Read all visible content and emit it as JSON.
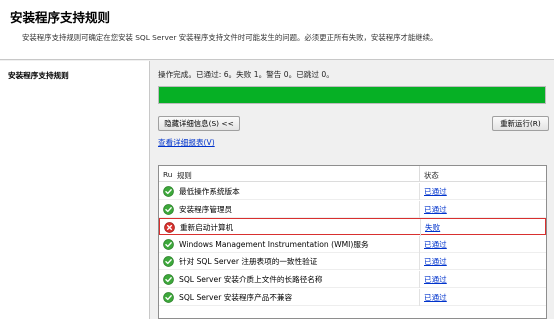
{
  "header": {
    "title": "安装程序支持规则",
    "description": "安装程序支持规则可确定在您安装 SQL Server 安装程序支持文件时可能发生的问题。必须更正所有失败，安装程序才能继续。"
  },
  "sidebar": {
    "items": [
      {
        "label": "安装程序支持规则"
      }
    ]
  },
  "main": {
    "status_text": "操作完成。已通过: 6。失败 1。警告 0。已跳过 0。",
    "progress_fraction": 1.0,
    "progress_color": "#06b025",
    "hide_details_label": "隐藏详细信息(S) <<",
    "rerun_label": "重新运行(R)",
    "report_link": "查看详细报表(V)",
    "table": {
      "headers": {
        "ru": "Ru",
        "rule": "规则",
        "status": "状态"
      },
      "rows": [
        {
          "icon": "check-circle-icon",
          "rule": "最低操作系统版本",
          "status": "已通过"
        },
        {
          "icon": "check-circle-icon",
          "rule": "安装程序管理员",
          "status": "已通过"
        },
        {
          "icon": "error-circle-icon",
          "rule": "重新启动计算机",
          "status": "失败"
        },
        {
          "icon": "check-circle-icon",
          "rule": "Windows Management Instrumentation (WMI)服务",
          "status": "已通过"
        },
        {
          "icon": "check-circle-icon",
          "rule": "针对 SQL Server 注册表项的一致性验证",
          "status": "已通过"
        },
        {
          "icon": "check-circle-icon",
          "rule": "SQL Server 安装介质上文件的长路径名称",
          "status": "已通过"
        },
        {
          "icon": "check-circle-icon",
          "rule": "SQL Server 安装程序产品不兼容",
          "status": "已通过"
        }
      ]
    }
  }
}
